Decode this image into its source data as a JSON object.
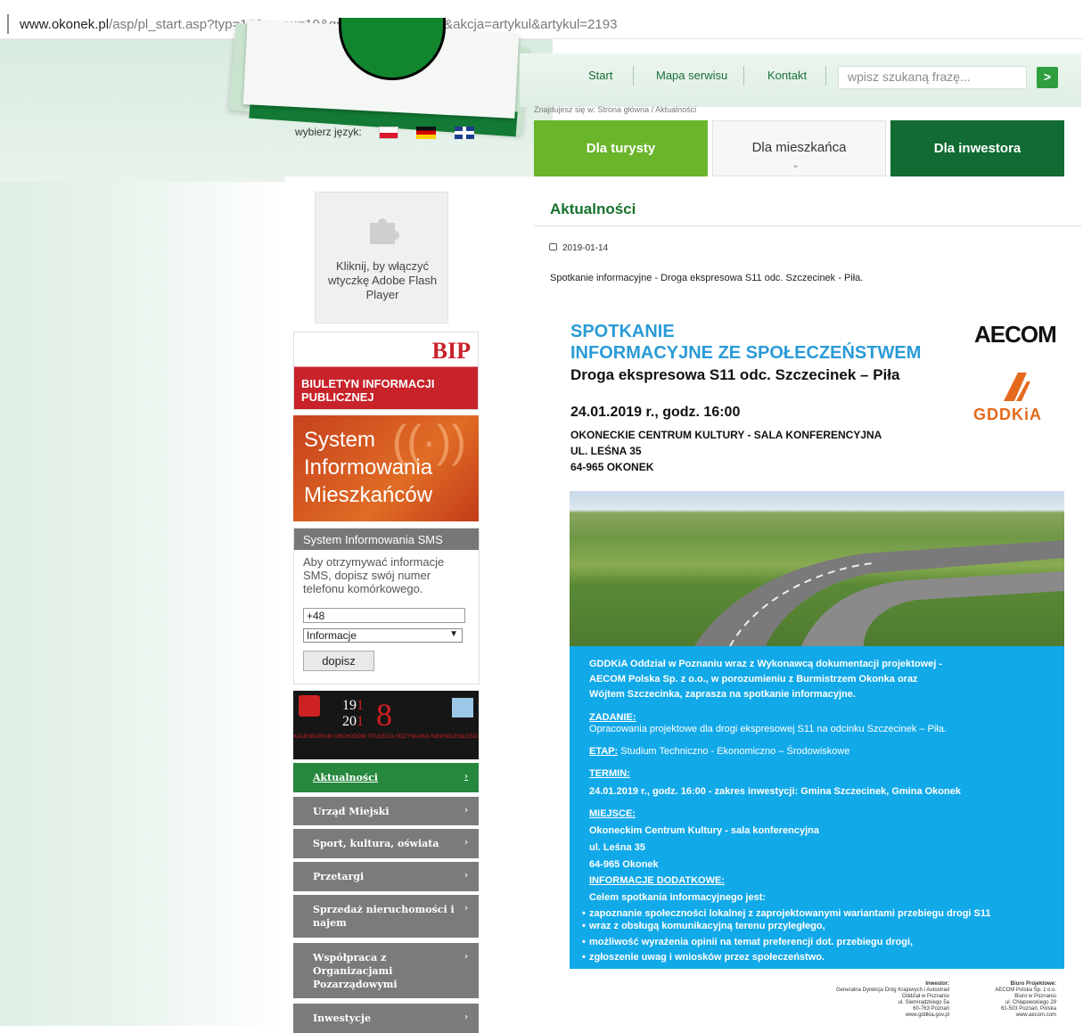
{
  "browser": {
    "url_host": "www.okonek.pl",
    "url_path": "/asp/pl_start.asp?typ=13&menu=10&grupa=2&dzialy=10&akcja=artykul&artykul=2193"
  },
  "header": {
    "lang_label": "wybierz język:",
    "flags": [
      "flag-pl-icon",
      "flag-de-icon",
      "flag-uk-icon"
    ],
    "nav": [
      "Start",
      "Mapa serwisu",
      "Kontakt"
    ],
    "search_placeholder": "wpisz szukaną frazę...",
    "search_button": ">",
    "breadcrumb_prefix": "Znajdujesz się w:",
    "breadcrumb": "Strona główna / Aktualności",
    "tabs": [
      "Dla turysty",
      "Dla mieszkańca",
      "Dla inwestora"
    ]
  },
  "sidebar": {
    "flash_text": "Kliknij, by włączyć wtyczkę Adobe Flash Player",
    "bip_logo": "BIP",
    "bip_text": [
      "BIULETYN INFORMACJI",
      "PUBLICZNEJ"
    ],
    "sim_lines": [
      "System",
      "Informowania",
      "Mieszkańców"
    ],
    "sms_title": "System Informowania SMS",
    "sms_desc": "Aby otrzymywać informacje SMS, dopisz swój numer telefonu komórkowego.",
    "sms_phone": "+48",
    "sms_select": "Informacje",
    "sms_button": "dopisz",
    "cal_year_top": "19",
    "cal_year_top_b": "1",
    "cal_year_bottom": "20",
    "cal_year_bottom_b": "1",
    "cal_big": "8",
    "cal_sub": "KALENDARIUM OBCHODÓW STULECIA ODZYSKANIA NIEPODLEGŁOŚCI",
    "menu": [
      "Aktualności",
      "Urząd Miejski",
      "Sport, kultura, oświata",
      "Przetargi",
      "Sprzedaż nieruchomości i najem",
      "Współpraca z Organizacjami Pozarządowymi",
      "Inwestycje"
    ]
  },
  "article": {
    "heading": "Aktualności",
    "date": "2019-01-14",
    "lead": "Spotkanie informacyjne - Droga ekspresowa S11 odc. Szczecinek - Piła."
  },
  "poster": {
    "t1": "SPOTKANIE",
    "t2": "INFORMACYJNE ZE SPOŁECZEŃSTWEM",
    "t3": "Droga ekspresowa S11 odc. Szczecinek – Piła",
    "date": "24.01.2019 r., godz. 16:00",
    "loc": [
      "OKONECKIE CENTRUM KULTURY - SALA KONFERENCYJNA",
      "UL. LEŚNA 35",
      "64-965 OKONEK"
    ],
    "aecom": "AECOM",
    "gddkia": "GDDKiA",
    "intro": [
      "GDDKiA Oddział w Poznaniu wraz z Wykonawcą dokumentacji projektowej -",
      "AECOM Polska Sp. z o.o., w porozumieniu z Burmistrzem Okonka oraz",
      "Wójtem Szczecinka, zaprasza na spotkanie informacyjne."
    ],
    "zadanie_h": "ZADANIE:",
    "zadanie": "Opracowania projektowe dla drogi ekspresowej S11 na odcinku Szczecinek – Piła.",
    "etap_h": "ETAP:",
    "etap": " Studium Techniczno - Ekonomiczno – Środowiskowe",
    "termin_h": "TERMIN:",
    "termin": "24.01.2019 r., godz. 16:00 - zakres inwestycji: Gmina Szczecinek, Gmina Okonek",
    "miejsce_h": "MIEJSCE:",
    "miejsce": [
      "Okoneckim Centrum Kultury - sala konferencyjna",
      "ul. Leśna 35",
      "64-965 Okonek"
    ],
    "info_h": "INFORMACJE DODATKOWE:",
    "info_lead": "Celem spotkania informacyjnego jest:",
    "bullets": [
      "zapoznanie społeczności lokalnej z zaprojektowanymi wariantami przebiegu drogi S11",
      "wraz z obsługą komunikacyjną terenu przyległego,",
      "możliwość wyrażenia opinii na temat preferencji dot. przebiegu drogi,",
      "zgłoszenie uwag i wniosków przez społeczeństwo."
    ],
    "investor": [
      "Inwestor:",
      "Generalna Dyrekcja Dróg Krajowych i Autostrad",
      "Oddział w Poznaniu",
      "ul. Siemiradzkiego 5a",
      "60-763 Poznań",
      "www.gddkia.gov.pl"
    ],
    "bureau": [
      "Biuro Projektowe:",
      "AECOM Polska Sp. z o.o.",
      "Biuro w Poznaniu",
      "ul. Chłapowskiego 29",
      "61-503 Poznań, Polska",
      "www.aecom.com"
    ]
  }
}
